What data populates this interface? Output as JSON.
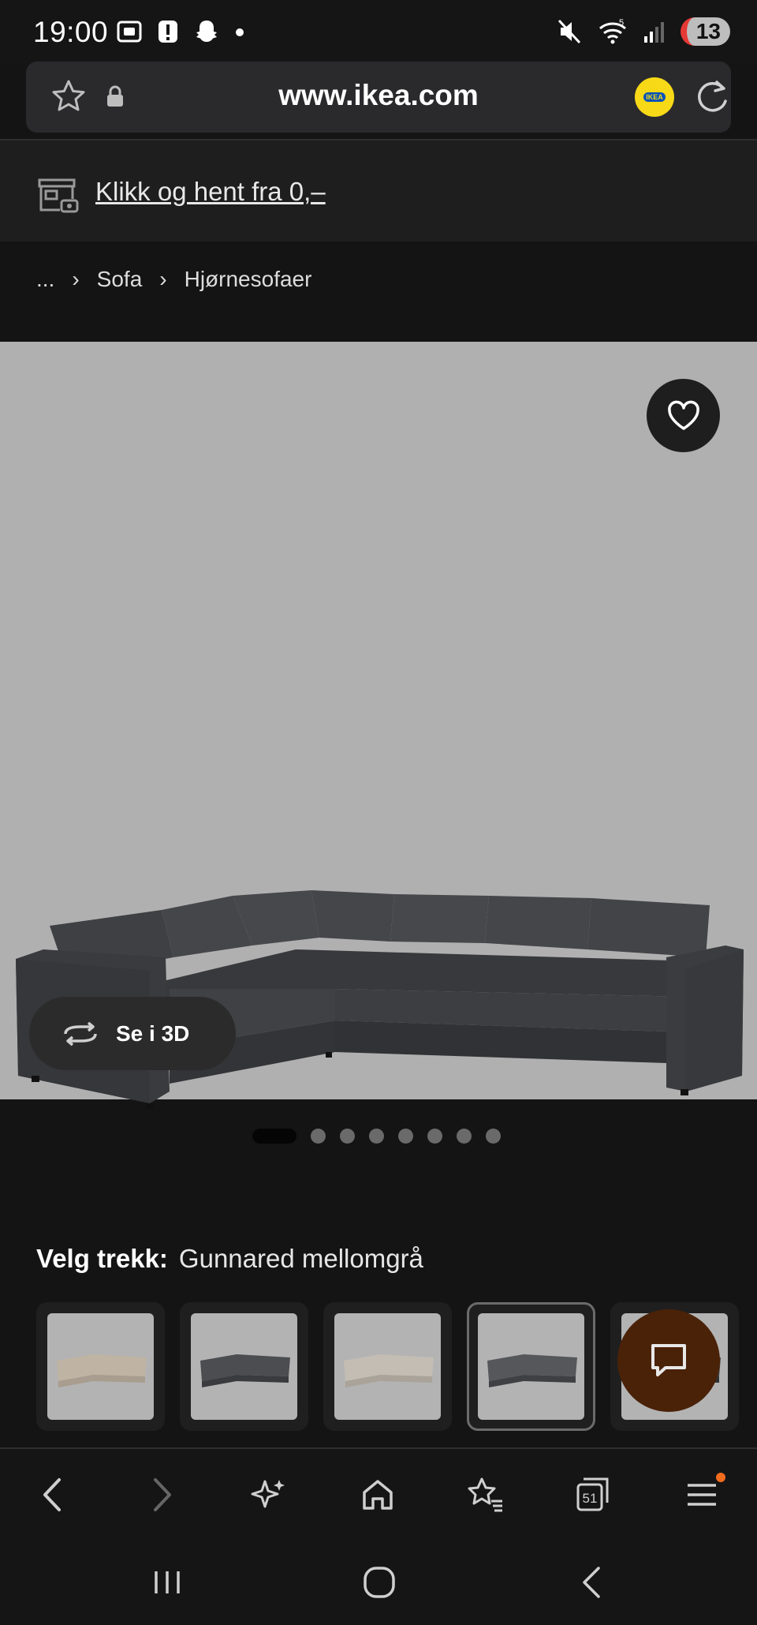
{
  "status_bar": {
    "time": "19:00",
    "notification_count": "13",
    "network": "5"
  },
  "url_bar": {
    "url": "www.ikea.com",
    "ikea_badge": "IKEA"
  },
  "pickup_banner": {
    "text": "Klikk og hent fra 0,–"
  },
  "breadcrumb": {
    "items": [
      "...",
      "Sofa",
      "Hjørnesofaer"
    ],
    "separator": "›"
  },
  "product_image": {
    "view_3d_label": "Se i 3D",
    "image_count": 8,
    "active_index": 0
  },
  "variant": {
    "label": "Velg trekk:",
    "selected": "Gunnared mellomgrå",
    "swatches": [
      {
        "color": "#bfb3a3"
      },
      {
        "color": "#4b4d50"
      },
      {
        "color": "#c3bdb4"
      },
      {
        "color": "#55575a",
        "selected": true
      },
      {
        "color": "#3f4042"
      }
    ]
  },
  "toolbar": {
    "tabs_count": "51"
  },
  "colors": {
    "background": "#141414",
    "product_bg": "#b0b0b0",
    "chat_button": "#4a2208",
    "notification_dot": "#f26b1d",
    "ikea_yellow": "#f7d917",
    "ikea_blue": "#0051ba"
  }
}
